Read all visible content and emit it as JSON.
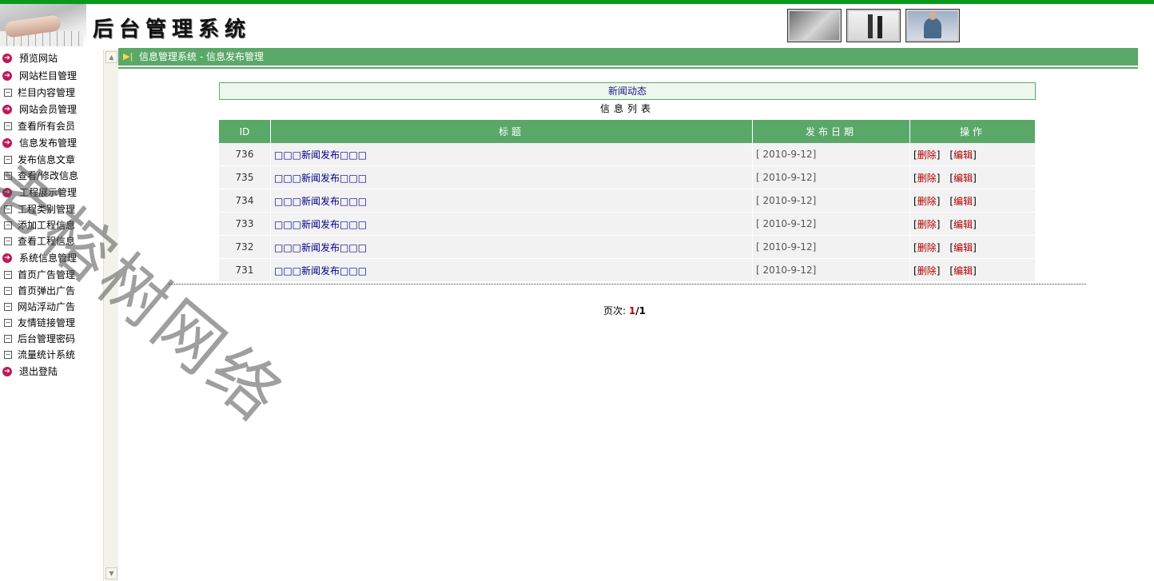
{
  "header": {
    "title": "后台管理系统"
  },
  "sidebar": {
    "items": [
      {
        "label": "预览网站",
        "type": "cat"
      },
      {
        "label": "网站栏目管理",
        "type": "cat"
      },
      {
        "label": "栏目内容管理",
        "type": "sub"
      },
      {
        "label": "网站会员管理",
        "type": "cat"
      },
      {
        "label": "查看所有会员",
        "type": "sub"
      },
      {
        "label": "信息发布管理",
        "type": "cat"
      },
      {
        "label": "发布信息文章",
        "type": "sub"
      },
      {
        "label": "查看/修改信息",
        "type": "sub"
      },
      {
        "label": "工程展示管理",
        "type": "cat"
      },
      {
        "label": "工程类别管理",
        "type": "sub"
      },
      {
        "label": "添加工程信息",
        "type": "sub"
      },
      {
        "label": "查看工程信息",
        "type": "sub"
      },
      {
        "label": "系统信息管理",
        "type": "cat"
      },
      {
        "label": "首页广告管理",
        "type": "sub"
      },
      {
        "label": "首页弹出广告",
        "type": "sub"
      },
      {
        "label": "网站浮动广告",
        "type": "sub"
      },
      {
        "label": "友情链接管理",
        "type": "sub"
      },
      {
        "label": "后台管理密码",
        "type": "sub"
      },
      {
        "label": "流量统计系统",
        "type": "sub"
      },
      {
        "label": "退出登陆",
        "type": "cat"
      }
    ]
  },
  "breadcrumb": {
    "text": "信息管理系统 - 信息发布管理"
  },
  "section": {
    "title": "新闻动态",
    "list_title": "信息列表"
  },
  "table": {
    "headers": {
      "id": "ID",
      "title": "标题",
      "date": "发布日期",
      "ops": "操作"
    },
    "rows": [
      {
        "id": "736",
        "title": "□□□新闻发布□□□",
        "date": "[ 2010-9-12]"
      },
      {
        "id": "735",
        "title": "□□□新闻发布□□□",
        "date": "[ 2010-9-12]"
      },
      {
        "id": "734",
        "title": "□□□新闻发布□□□",
        "date": "[ 2010-9-12]"
      },
      {
        "id": "733",
        "title": "□□□新闻发布□□□",
        "date": "[ 2010-9-12]"
      },
      {
        "id": "732",
        "title": "□□□新闻发布□□□",
        "date": "[ 2010-9-12]"
      },
      {
        "id": "731",
        "title": "□□□新闻发布□□□",
        "date": "[ 2010-9-12]"
      }
    ],
    "ops": {
      "delete": "删除",
      "edit": "编辑",
      "open": "[",
      "close": "]"
    }
  },
  "pager": {
    "label": "页次:",
    "current": "1",
    "total": "/1"
  },
  "watermark": {
    "text": "老榕树网络"
  },
  "colors": {
    "accent_green": "#5aa868",
    "top_bar": "#0a9a1a",
    "category_icon": "#c0185a",
    "link_red": "#b00000"
  },
  "icons": {
    "category": "arrow-circle-icon",
    "sub": "minus-box-icon",
    "breadcrumb": "play-arrow-icon"
  }
}
